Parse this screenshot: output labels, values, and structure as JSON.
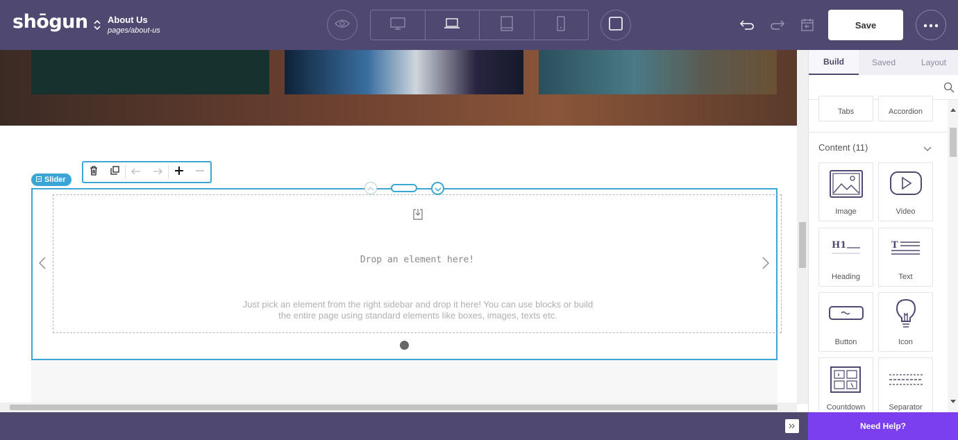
{
  "header": {
    "logo": "shōgun",
    "page_title": "About Us",
    "page_path": "pages/about-us",
    "save_label": "Save"
  },
  "canvas": {
    "slider_tag": "Slider",
    "drop_title": "Drop an element here!",
    "drop_desc_line1": "Just pick an element from the right sidebar and drop it here! You can use blocks or build",
    "drop_desc_line2": "the entire page using standard elements like boxes, images, texts etc."
  },
  "sidebar": {
    "tabs": [
      "Build",
      "Saved",
      "Layout"
    ],
    "top_tiles": [
      "Tabs",
      "Accordion"
    ],
    "category": "Content (11)",
    "tiles": [
      "Image",
      "Video",
      "Heading",
      "Text",
      "Button",
      "Icon",
      "Countdown",
      "Separator"
    ]
  },
  "help_label": "Need Help?",
  "colors": {
    "topbar": "#4f4870",
    "accent": "#3ba6d6",
    "help": "#7b3ff0"
  }
}
